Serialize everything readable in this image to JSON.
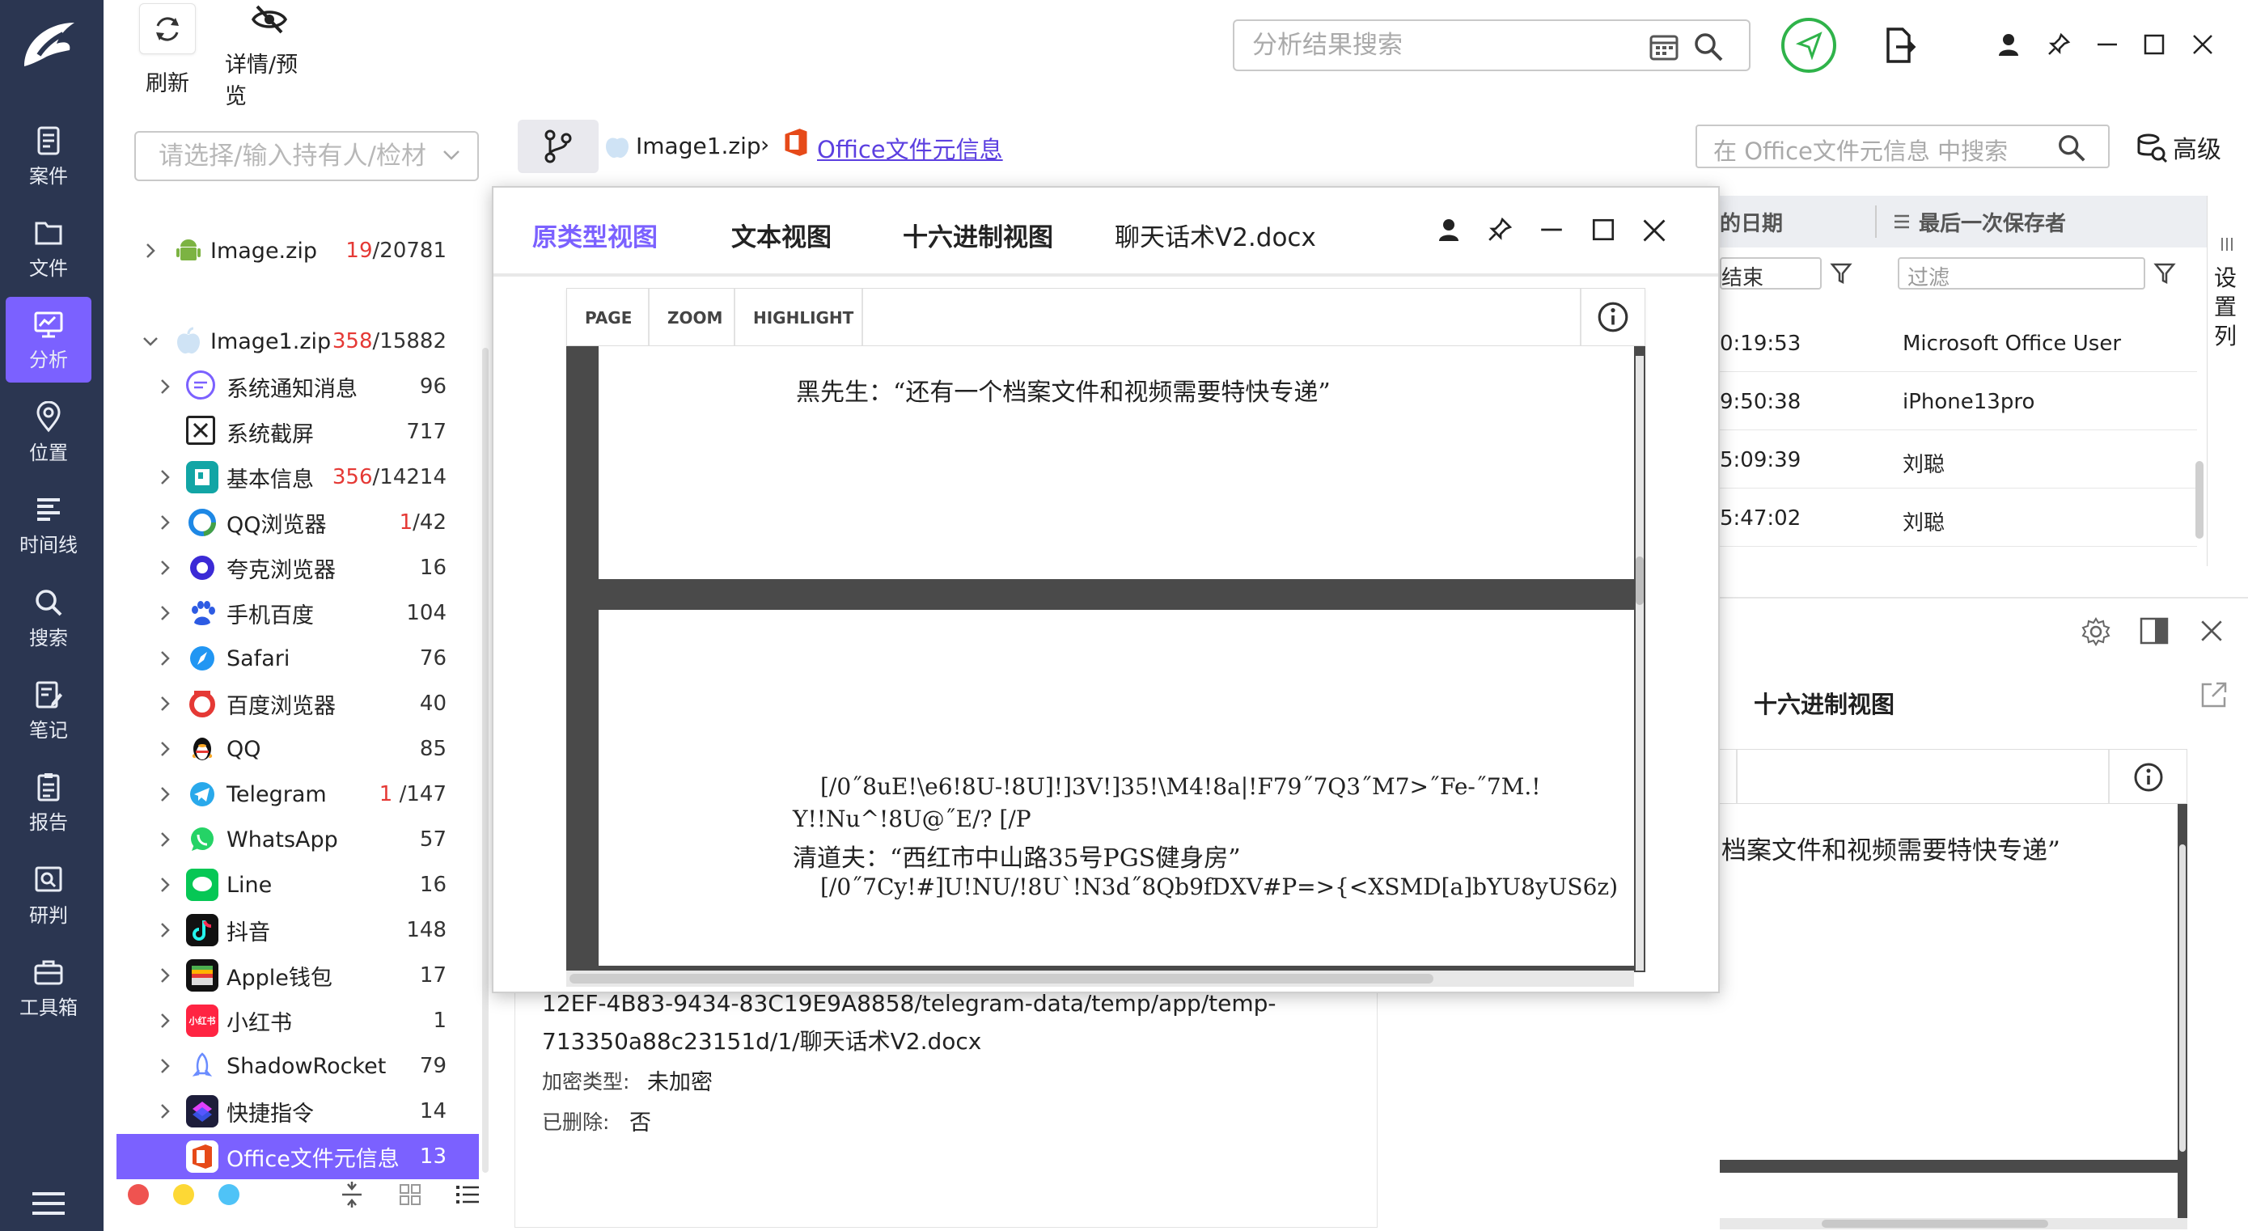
{
  "app": {
    "rail": [
      {
        "id": "case",
        "label": "案件"
      },
      {
        "id": "file",
        "label": "文件"
      },
      {
        "id": "analysis",
        "label": "分析"
      },
      {
        "id": "location",
        "label": "位置"
      },
      {
        "id": "timeline",
        "label": "时间线"
      },
      {
        "id": "search",
        "label": "搜索"
      },
      {
        "id": "notes",
        "label": "笔记"
      },
      {
        "id": "report",
        "label": "报告"
      },
      {
        "id": "judge",
        "label": "研判"
      },
      {
        "id": "toolbox",
        "label": "工具箱"
      }
    ]
  },
  "toolbar": {
    "refresh_label": "刷新",
    "preview_label": "详情/预览",
    "search_placeholder": "分析结果搜索"
  },
  "left": {
    "owner_placeholder": "请选择/输入持有人/检材",
    "tree": [
      {
        "label": "Image.zip",
        "red": "19",
        "total": "/20781"
      },
      {
        "label": "Image1.zip",
        "red": "358",
        "total": "/15882"
      },
      {
        "label": "系统通知消息",
        "count": "96"
      },
      {
        "label": "系统截屏",
        "count": "717"
      },
      {
        "label": "基本信息",
        "red": "356",
        "total": "/14214"
      },
      {
        "label": "QQ浏览器",
        "red": "1",
        "total": "/42"
      },
      {
        "label": "夸克浏览器",
        "count": "16"
      },
      {
        "label": "手机百度",
        "count": "104"
      },
      {
        "label": "Safari",
        "count": "76"
      },
      {
        "label": "百度浏览器",
        "count": "40"
      },
      {
        "label": "QQ",
        "count": "85"
      },
      {
        "label": "Telegram",
        "red": "1",
        "total": " /147"
      },
      {
        "label": "WhatsApp",
        "count": "57"
      },
      {
        "label": "Line",
        "count": "16"
      },
      {
        "label": "抖音",
        "count": "148"
      },
      {
        "label": "Apple钱包",
        "count": "17"
      },
      {
        "label": "小红书",
        "count": "1"
      },
      {
        "label": "ShadowRocket",
        "count": "79"
      },
      {
        "label": "快捷指令",
        "count": "14"
      },
      {
        "label": "Office文件元信息",
        "count": "13"
      }
    ],
    "icons": {
      "xhs": "小红书"
    }
  },
  "breadcrumb": {
    "root": "Image1.zip",
    "sep": "›",
    "current": "Office文件元信息",
    "search_placeholder": "在 Office文件元信息 中搜索",
    "advanced": "高级"
  },
  "table": {
    "col_date": "的日期",
    "col_saver": "最后一次保存者",
    "filter_end": "结束",
    "filter_placeholder": "过滤",
    "settings_cols": "设置列",
    "rows": [
      {
        "time": "0:19:53",
        "saver": "Microsoft Office User"
      },
      {
        "time": "9:50:38",
        "saver": "iPhone13pro"
      },
      {
        "time": "5:09:39",
        "saver": "刘聪"
      },
      {
        "time": "5:47:02",
        "saver": "刘聪"
      }
    ]
  },
  "right_detail": {
    "hex_title": "十六进制视图",
    "text_line": "档案文件和视频需要特快专递”"
  },
  "detail": {
    "path_line1": "12EF-4B83-9434-83C19E9A8858/telegram-data/temp/app/temp-",
    "path_line2": "713350a88c23151d/1/聊天话术V2.docx",
    "enc_label": "加密类型:",
    "enc_value": "未加密",
    "del_label": "已删除:",
    "del_value": "否"
  },
  "modal": {
    "tab_original": "原类型视图",
    "tab_text": "文本视图",
    "tab_hex": "十六进制视图",
    "filename": "聊天话术V2.docx",
    "viewer_tabs": [
      "PAGE",
      "ZOOM",
      "HIGHLIGHT"
    ],
    "page1_line": "黑先生：“还有一个档案文件和视频需要特快专递”",
    "page2_lines": [
      "[/0˝8uE!\\e6!8U-!8U]!]3V!]35!\\M4!8a|!F79˝7Q3˝M7>˝Fe-˝7M.!",
      "Y!!Nu^!8U@˝E/? [/P",
      "清道夫：“西红市中山路35号PGS健身房”",
      "[/0˝7Cy!#]U!NU/!8U`!N3d˝8Qb9fDXV#P=>{<XSMD[a]bYU8yUS6z)"
    ]
  },
  "colors": {
    "accent": "#7b61ff",
    "rail": "#2b3651",
    "red": "#e53935",
    "office": "#e64a19"
  }
}
